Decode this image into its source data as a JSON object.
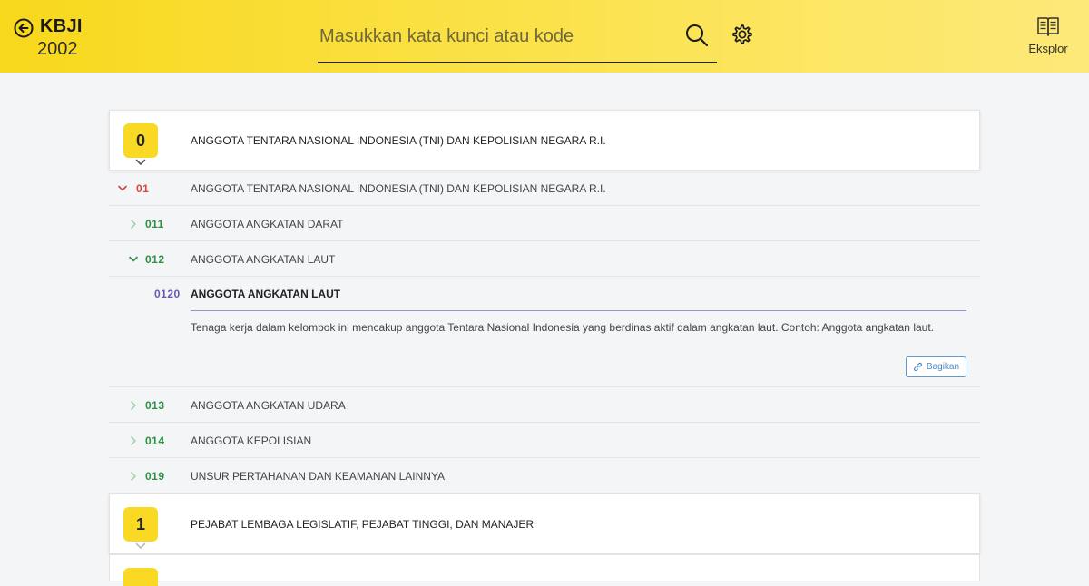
{
  "header": {
    "app_name": "KBJI",
    "app_year": "2002",
    "search_placeholder": "Masukkan kata kunci atau kode",
    "explore_label": "Eksplor"
  },
  "groups": [
    {
      "code": "0",
      "title": "ANGGOTA TENTARA NASIONAL INDONESIA (TNI) DAN KEPOLISIAN NEGARA R.I."
    },
    {
      "code": "1",
      "title": "PEJABAT LEMBAGA LEGISLATIF, PEJABAT TINGGI, DAN MANAJER"
    }
  ],
  "subgroup": {
    "code": "01",
    "title": "ANGGOTA TENTARA NASIONAL INDONESIA (TNI) DAN KEPOLISIAN NEGARA R.I.",
    "items": [
      {
        "code": "011",
        "title": "ANGGOTA ANGKATAN DARAT"
      },
      {
        "code": "012",
        "title": "ANGGOTA ANGKATAN LAUT"
      },
      {
        "code": "013",
        "title": "ANGGOTA ANGKATAN UDARA"
      },
      {
        "code": "014",
        "title": "ANGGOTA KEPOLISIAN"
      },
      {
        "code": "019",
        "title": "UNSUR PERTAHANAN DAN KEAMANAN LAINNYA"
      }
    ]
  },
  "detail": {
    "code": "0120",
    "title": "ANGGOTA ANGKATAN LAUT",
    "description": "Tenaga kerja dalam kelompok ini mencakup anggota Tentara Nasional Indonesia yang berdinas aktif dalam angkatan laut. Contoh: Anggota angkatan laut.",
    "share_label": "Bagikan"
  },
  "colors": {
    "header_yellow": "#f8d81c",
    "badge_yellow": "#fad924",
    "level1_red": "#d64545",
    "level2_green": "#2f8f46",
    "detail_purple": "#6a58b0",
    "share_blue": "#4a8ac8"
  },
  "icons": {
    "back": "arrow-left-circle-icon",
    "search": "search-icon",
    "settings": "gear-icon",
    "explore": "book-open-icon",
    "share": "link-icon",
    "expand": "chevron-down-icon",
    "collapse": "chevron-right-icon"
  }
}
